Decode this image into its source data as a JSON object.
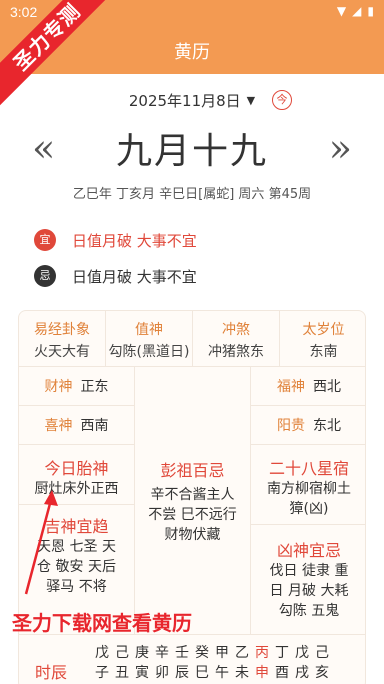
{
  "status": {
    "time": "3:02"
  },
  "app": {
    "title": "黄历",
    "ribbon": "圣力专测"
  },
  "date_selector": {
    "date": "2025年11月8日",
    "today_label": "今"
  },
  "lunar": {
    "date": "九月十九",
    "prev": "«",
    "next": "»"
  },
  "ganzhi": "乙巳年 丁亥月 辛巳日[属蛇] 周六 第45周",
  "notices": [
    {
      "badge": "宜",
      "text": "日值月破 大事不宜"
    },
    {
      "badge": "忌",
      "text": "日值月破 大事不宜"
    }
  ],
  "top_row": [
    {
      "title": "易经卦象",
      "value": "火天大有"
    },
    {
      "title": "值神",
      "value": "勾陈(黑道日)"
    },
    {
      "title": "冲煞",
      "value": "冲猪煞东"
    },
    {
      "title": "太岁位",
      "value": "东南"
    }
  ],
  "gods": {
    "caishen": {
      "k": "财神",
      "v": "正东"
    },
    "xishen": {
      "k": "喜神",
      "v": "西南"
    },
    "fushen": {
      "k": "福神",
      "v": "西北"
    },
    "yanggui": {
      "k": "阳贵",
      "v": "东北"
    }
  },
  "taishen": {
    "title": "今日胎神",
    "value": "厨灶床外正西"
  },
  "pengzu": {
    "title": "彭祖百忌",
    "line1": "辛不合酱主人",
    "line2": "不尝 巳不远行",
    "line3": "财物伏藏"
  },
  "xiu": {
    "title": "二十八星宿",
    "line1": "南方柳宿柳土",
    "line2": "獐(凶)"
  },
  "jishen": {
    "title": "吉神宜趋",
    "line1": "天恩 七圣 天",
    "line2": "仓 敬安 天后",
    "line3": "驿马 不将"
  },
  "xiongshen": {
    "title": "凶神宜忌",
    "line1": "伐日 徒隶 重",
    "line2": "日 月破 大耗",
    "line3": "勾陈 五鬼"
  },
  "hours": {
    "label": "时辰",
    "cols": [
      {
        "top": "戊",
        "bottom": "子"
      },
      {
        "top": "己",
        "bottom": "丑"
      },
      {
        "top": "庚",
        "bottom": "寅"
      },
      {
        "top": "辛",
        "bottom": "卯"
      },
      {
        "top": "壬",
        "bottom": "辰"
      },
      {
        "top": "癸",
        "bottom": "巳"
      },
      {
        "top": "甲",
        "bottom": "午"
      },
      {
        "top": "乙",
        "bottom": "未"
      },
      {
        "top": "丙",
        "bottom": "申"
      },
      {
        "top": "丁",
        "bottom": "酉"
      },
      {
        "top": "戊",
        "bottom": "戌"
      },
      {
        "top": "己",
        "bottom": "亥"
      }
    ]
  },
  "watermark": "圣力下载网查看黄历",
  "colors": {
    "header": "#F39A52",
    "accent_red": "#E0483A",
    "orange_text": "#E0823A",
    "ribbon": "#E8262D"
  }
}
